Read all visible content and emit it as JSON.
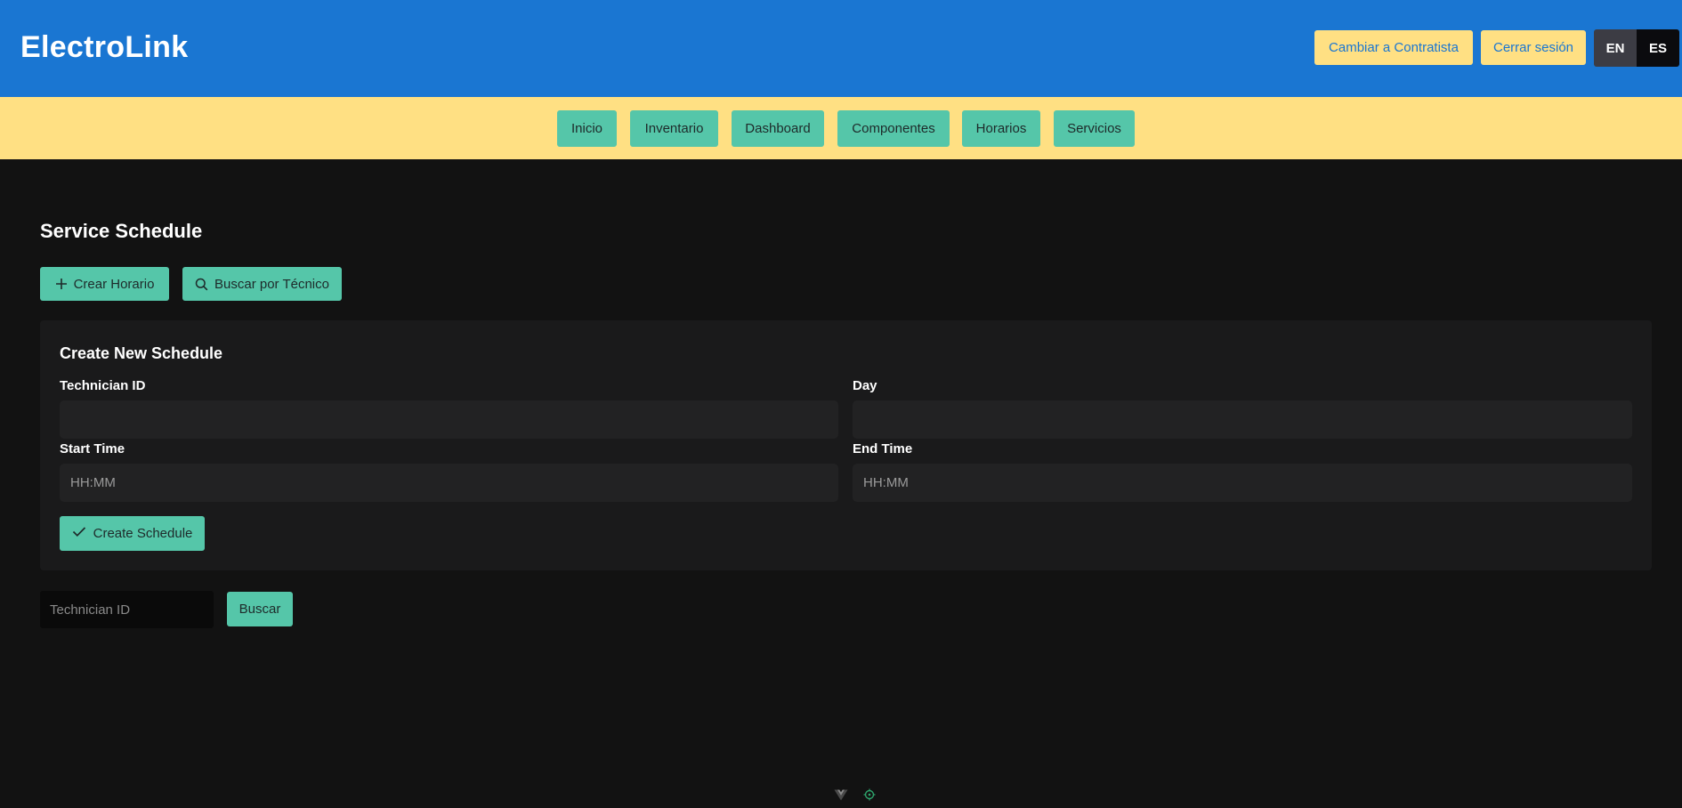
{
  "header": {
    "brand": "ElectroLink",
    "switch_role_label": "Cambiar a Contratista",
    "logout_label": "Cerrar sesión",
    "lang_en": "EN",
    "lang_es": "ES"
  },
  "nav": {
    "items": [
      {
        "label": "Inicio"
      },
      {
        "label": "Inventario"
      },
      {
        "label": "Dashboard"
      },
      {
        "label": "Componentes"
      },
      {
        "label": "Horarios"
      },
      {
        "label": "Servicios"
      }
    ]
  },
  "main": {
    "title": "Service Schedule",
    "create_button_label": "Crear Horario",
    "search_tech_button_label": "Buscar por Técnico"
  },
  "form": {
    "title": "Create New Schedule",
    "technician_label": "Technician ID",
    "technician_value": "",
    "day_label": "Day",
    "day_value": "",
    "start_label": "Start Time",
    "start_placeholder": "HH:MM",
    "end_label": "End Time",
    "end_placeholder": "HH:MM",
    "submit_label": "Create Schedule"
  },
  "search": {
    "placeholder": "Technician ID",
    "button_label": "Buscar"
  },
  "colors": {
    "header_bg": "#1a76d2",
    "nav_bg": "#ffe083",
    "accent": "#55c6a9",
    "page_bg": "#121212",
    "card_bg": "#1a1a1b"
  },
  "icons": {
    "create": "plus-icon",
    "search": "search-icon",
    "submit": "check-icon",
    "devtools_vue": "vue-logo-icon",
    "devtools_inspect": "inspect-icon"
  }
}
